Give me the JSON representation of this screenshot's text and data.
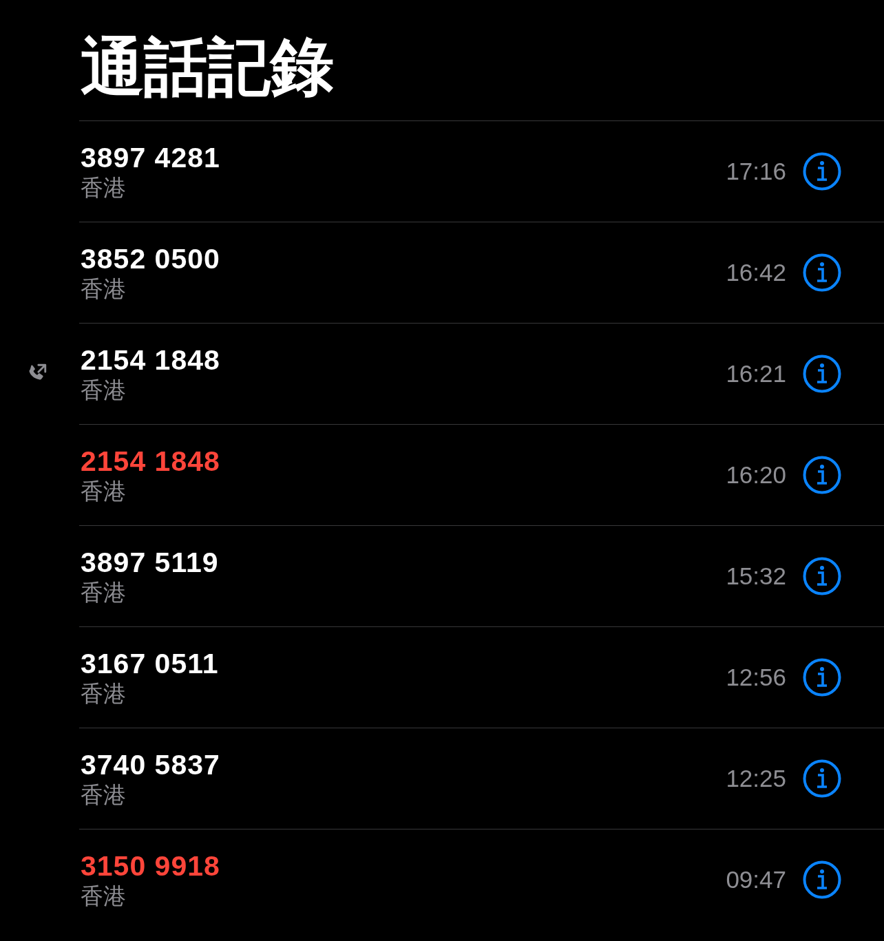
{
  "title": "通話記錄",
  "calls": [
    {
      "number": "3897 4281",
      "location": "香港",
      "time": "17:16",
      "missed": false,
      "outgoing": false
    },
    {
      "number": "3852 0500",
      "location": "香港",
      "time": "16:42",
      "missed": false,
      "outgoing": false
    },
    {
      "number": "2154 1848",
      "location": "香港",
      "time": "16:21",
      "missed": false,
      "outgoing": true
    },
    {
      "number": "2154 1848",
      "location": "香港",
      "time": "16:20",
      "missed": true,
      "outgoing": false
    },
    {
      "number": "3897 5119",
      "location": "香港",
      "time": "15:32",
      "missed": false,
      "outgoing": false
    },
    {
      "number": "3167 0511",
      "location": "香港",
      "time": "12:56",
      "missed": false,
      "outgoing": false
    },
    {
      "number": "3740 5837",
      "location": "香港",
      "time": "12:25",
      "missed": false,
      "outgoing": false
    },
    {
      "number": "3150 9918",
      "location": "香港",
      "time": "09:47",
      "missed": true,
      "outgoing": false
    }
  ]
}
